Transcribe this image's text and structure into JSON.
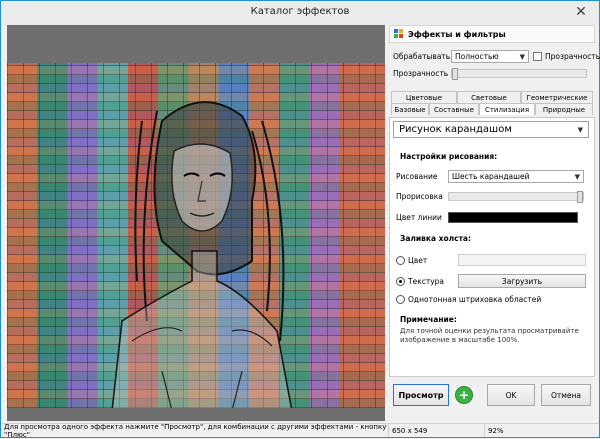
{
  "window": {
    "title": "Каталог эффектов",
    "close_glyph": "✕"
  },
  "panel": {
    "header": "Эффекты и фильтры",
    "process_label": "Обрабатывать",
    "process_value": "Полностью",
    "transparency_check_label": "Прозрачность",
    "opacity_label": "Прозрачность",
    "tabs_top": [
      "Цветовые",
      "Световые",
      "Геометрические"
    ],
    "tabs_bottom": [
      "Базовые",
      "Составные",
      "Стилизация",
      "Природные"
    ],
    "active_tab": "Стилизация",
    "effect_select": "Рисунок карандашом",
    "drawing_settings_title": "Настройки рисования:",
    "drawing_label": "Рисование",
    "drawing_value": "Шесть карандашей",
    "tracing_label": "Прорисовка",
    "line_color_label": "Цвет линии",
    "line_color": "#000000",
    "canvas_fill_title": "Заливка холста:",
    "color_radio_label": "Цвет",
    "texture_radio_label": "Текстура",
    "load_button": "Загрузить",
    "hatch_radio_label": "Однотонная штриховка областей",
    "note_title": "Примечание:",
    "note_text": "Для точной оценки результата просматривайте изображение в масштабе 100%."
  },
  "buttons": {
    "preview": "Просмотр",
    "ok": "OK",
    "cancel": "Отмена"
  },
  "status": {
    "hint": "Для просмотра одного эффекта нажмите \"Просмотр\", для комбинации с другими эффектами - кнопку \"Плюс\"",
    "size": "650 x 549",
    "zoom": "92%"
  },
  "colors": {
    "accent_border": "#1f8fd6",
    "add_button": "#3cb043"
  }
}
